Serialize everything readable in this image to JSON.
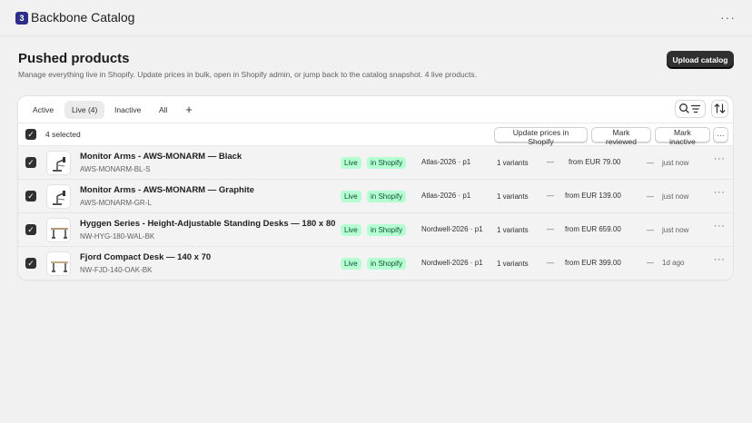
{
  "app": {
    "logo_glyph": "3",
    "title": "Backbone Catalog",
    "more_glyph": "···"
  },
  "page": {
    "title": "Pushed products",
    "subtitle": "Manage everything live in Shopify. Update prices in bulk, open in Shopify admin, or jump back to the catalog snapshot. 4 live products.",
    "upload_label": "Upload catalog"
  },
  "tabs": [
    {
      "label": "Active",
      "selected": false
    },
    {
      "label": "Live (4)",
      "selected": true
    },
    {
      "label": "Inactive",
      "selected": false
    },
    {
      "label": "All",
      "selected": false
    }
  ],
  "tab_add_glyph": "+",
  "toolbar": {
    "search_filter_icon": "search-filter-icon",
    "sort_icon": "sort-icon"
  },
  "bulk": {
    "checked_glyph": "✓",
    "selected_label": "4 selected",
    "update_prices_label": "Update prices in Shopify",
    "mark_reviewed_label": "Mark reviewed",
    "mark_inactive_label": "Mark inactive",
    "more_glyph": "···"
  },
  "products": [
    {
      "title": "Monitor Arms - AWS-MONARM — Black",
      "sku": "AWS-MONARM-BL-S",
      "status": "Live",
      "channel": "in Shopify",
      "snapshot": "Atlas-2026 · p1",
      "variants": "1 variants",
      "dash1": "—",
      "price": "from EUR 79.00",
      "dash2": "—",
      "updated": "just now",
      "thumb": "monitor-arm"
    },
    {
      "title": "Monitor Arms - AWS-MONARM — Graphite",
      "sku": "AWS-MONARM-GR-L",
      "status": "Live",
      "channel": "in Shopify",
      "snapshot": "Atlas-2026 · p1",
      "variants": "1 variants",
      "dash1": "—",
      "price": "from EUR 139.00",
      "dash2": "—",
      "updated": "just now",
      "thumb": "monitor-arm"
    },
    {
      "title": "Hyggen Series - Height-Adjustable Standing Desks — 180 x 80",
      "sku": "NW-HYG-180-WAL-BK",
      "status": "Live",
      "channel": "in Shopify",
      "snapshot": "Nordwell-2026 · p1",
      "variants": "1 variants",
      "dash1": "—",
      "price": "from EUR 659.00",
      "dash2": "—",
      "updated": "just now",
      "thumb": "desk"
    },
    {
      "title": "Fjord Compact Desk — 140 x 70",
      "sku": "NW-FJD-140-OAK-BK",
      "status": "Live",
      "channel": "in Shopify",
      "snapshot": "Nordwell-2026 · p1",
      "variants": "1 variants",
      "dash1": "—",
      "price": "from EUR 399.00",
      "dash2": "—",
      "updated": "1d ago",
      "thumb": "desk"
    }
  ],
  "row_more_glyph": "···",
  "colors": {
    "badge_bg": "#b4fed2",
    "badge_text": "#0c5132",
    "primary_button": "#303030",
    "logo": "#2d2d8a"
  }
}
